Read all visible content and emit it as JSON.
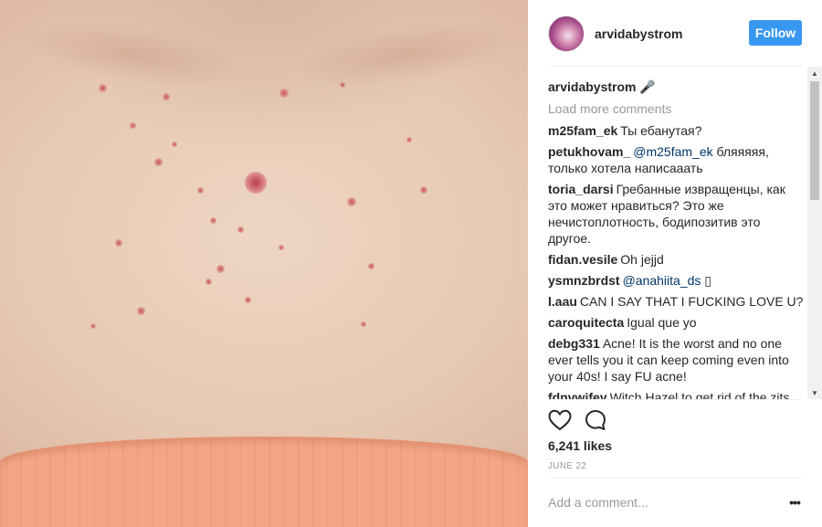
{
  "post": {
    "username": "arvidabystrom",
    "follow_label": "Follow",
    "caption": {
      "username": "arvidabystrom",
      "emoji": "🎤"
    },
    "load_more": "Load more comments",
    "comments": [
      {
        "user": "m25fam_ek",
        "mention": "",
        "text": "Ты ебанутая?"
      },
      {
        "user": "petukhovam_",
        "mention": "@m25fam_ek",
        "text": "бляяяяя, только хотела написааать"
      },
      {
        "user": "toria_darsi",
        "mention": "",
        "text": "Гребанные извращенцы, как это может нравиться? Это же нечистоплотность, бодипозитив это другое."
      },
      {
        "user": "fidan.vesile",
        "mention": "",
        "text": "Oh jejjd"
      },
      {
        "user": "ysmnzbrdst",
        "mention": "@anahiita_ds",
        "text": "▯"
      },
      {
        "user": "l.aau",
        "mention": "",
        "text": "CAN I SAY THAT I FUCKING LOVE U?"
      },
      {
        "user": "caroquitecta",
        "mention": "",
        "text": "Igual que yo"
      },
      {
        "user": "debg331",
        "mention": "",
        "text": "Acne! It is the worst and no one ever tells you it can keep coming even into your 40s! I say FU acne!"
      },
      {
        "user": "fdnvwifey",
        "mention": "",
        "text": "Witch Hazel to get rid of the zits."
      }
    ],
    "likes": "6,241 likes",
    "date": "JUNE 22",
    "add_comment_placeholder": "Add a comment...",
    "more_label": "•••"
  },
  "icons": {
    "like": "heart-icon",
    "comment": "speech-bubble-icon",
    "more": "ellipsis-icon"
  },
  "colors": {
    "follow_button": "#3897f0",
    "mention": "#003569",
    "muted": "#999999"
  }
}
